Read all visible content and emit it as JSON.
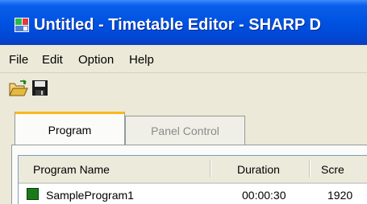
{
  "window": {
    "title": "Untitled - Timetable Editor - SHARP D"
  },
  "menubar": {
    "items": [
      "File",
      "Edit",
      "Option",
      "Help"
    ]
  },
  "toolbar": {
    "buttons": [
      "open-folder-icon",
      "save-disk-icon"
    ]
  },
  "tabs": [
    {
      "label": "Program",
      "active": true
    },
    {
      "label": "Panel Control",
      "active": false
    }
  ],
  "table": {
    "columns": [
      "Program Name",
      "Duration",
      "Scre"
    ],
    "rows": [
      {
        "name": "SampleProgram1",
        "duration": "00:00:30",
        "screen": "1920",
        "status_color": "#1a7a1a"
      }
    ]
  },
  "colors": {
    "titlebar": "#0054e3",
    "active_tab_accent": "#f9b81a",
    "window_bg": "#ece9d8"
  }
}
